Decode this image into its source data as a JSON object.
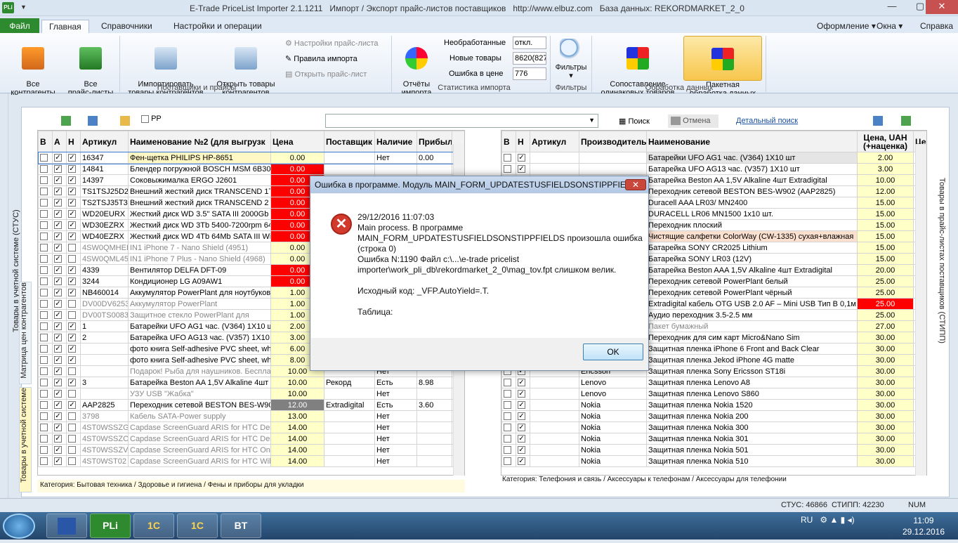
{
  "window": {
    "title": "E-Trade PriceList Importer 2.1.1211   Импорт / Экспорт прайс-листов поставщиков   http://www.elbuz.com   База данных: REKORDMARKET_2_0",
    "app_icon": "PLi"
  },
  "tabs": {
    "file": "Файл",
    "main": "Главная",
    "refs": "Справочники",
    "settings": "Настройки и операции",
    "design": "Оформление",
    "windows": "Окна",
    "help": "Справка"
  },
  "ribbon": {
    "all_contractors": "Все\nконтрагенты",
    "all_pricelists": "Все\nпрайс-листы",
    "imported_goods": "Импортировать\nтовары контрагентов",
    "open_goods": "Открыть товары\nконтрагентов",
    "pricelist_settings": "Настройки прайс-листа",
    "import_rules": "Правила импорта",
    "open_pricelist": "Открыть прайс-лист",
    "reports": "Отчёты\nимпорта",
    "unprocessed_label": "Необработанные",
    "unprocessed_val": "откл.",
    "new_label": "Новые товары",
    "new_val": "8620(827",
    "price_err_label": "Ошибка в цене",
    "price_err_val": "776",
    "filters": "Фильтры",
    "matching": "Сопоставление\nодинаковых товаров",
    "batch": "Пакетная\nобработка данных",
    "g1": "Поставщики и прайсы",
    "g2": "Статистика импорта",
    "g3": "Фильтры",
    "g4": "Обработка данных"
  },
  "toolbar": {
    "pp_label": "PP",
    "search": "Поиск",
    "cancel": "Отмена",
    "adv_search": "Детальный поиск"
  },
  "left_tabs": {
    "t1": "Товары в учетной системе (СТУС)",
    "t2": "Матрица цен контрагентов",
    "t3": "Товары в учетной системе"
  },
  "right_tab": "Товары в прайс-листах поставщиков (СТИПП)",
  "left_table": {
    "headers": [
      "В",
      "А",
      "Н",
      "Артикул",
      "Наименование №2 (для выгрузк",
      "Цена",
      "Поставщик",
      "Наличие",
      "Прибыль"
    ],
    "rows": [
      [
        "16347",
        "Фен-щетка PHILIPS HP-8651",
        "0.00",
        "",
        "Нет",
        "0.00",
        "y",
        "1"
      ],
      [
        "14841",
        "Блендер погружной BOSCH MSM 6B300",
        "0.00",
        "",
        "",
        "",
        "r",
        "1"
      ],
      [
        "14397",
        "Соковыжималка ERGO J2601",
        "0.00",
        "",
        "",
        "",
        "r",
        "1"
      ],
      [
        "TS1TSJ25D2",
        "Внешний жесткий диск TRANSCEND 1TB",
        "0.00",
        "",
        "",
        "",
        "r",
        "1"
      ],
      [
        "TS2TSJ35T3",
        "Внешний жесткий диск TRANSCEND 2 TB",
        "0.00",
        "",
        "",
        "",
        "r",
        "1"
      ],
      [
        "WD20EURX",
        "Жесткий диск WD 3.5\" SATA III 2000Gb",
        "0.00",
        "",
        "",
        "",
        "r",
        "1"
      ],
      [
        "WD30EZRX",
        "Жесткий диск WD 3Tb 5400-7200rpm 64",
        "0.00",
        "",
        "",
        "",
        "r",
        "1"
      ],
      [
        "WD40EZRX",
        "Жесткий диск WD 4Tb 64Mb SATA III Wi",
        "0.00",
        "",
        "",
        "",
        "r",
        "1"
      ],
      [
        "4SW0QMHEE",
        "IN1 iPhone 7 - Nano Shield (4951)",
        "0.00",
        "",
        "",
        "",
        "y",
        "0"
      ],
      [
        "4SW0QML45",
        "IN1 iPhone 7 Plus - Nano Shield (4968)",
        "0.00",
        "",
        "",
        "",
        "y",
        "0"
      ],
      [
        "4339",
        "Вентилятор DELFA DFT-09",
        "0.00",
        "",
        "",
        "",
        "r",
        "1"
      ],
      [
        "3244",
        "Кондиционер LG A09AW1",
        "0.00",
        "",
        "",
        "",
        "r",
        "1"
      ],
      [
        "NB460014",
        "Аккумулятор PowerPlant для ноутбуков",
        "1.00",
        "",
        "",
        "",
        "y",
        "1"
      ],
      [
        "DV00DV6253",
        "Аккумулятор PowerPlant",
        "1.00",
        "",
        "",
        "",
        "y",
        "0"
      ],
      [
        "DV00TS0083",
        "Защитное стекло PowerPlant для",
        "1.00",
        "",
        "",
        "",
        "y",
        "0"
      ],
      [
        "1",
        "Батарейки UFO AG1 час. (V364) 1X10 ш",
        "2.00",
        "",
        "",
        "",
        "y",
        "1"
      ],
      [
        "2",
        "Батарейка UFO AG13 час. (V357) 1X10 ш",
        "3.00",
        "",
        "",
        "",
        "y",
        "1"
      ],
      [
        "",
        "фото книга  Self-adhesive PVC sheet, wh",
        "6.00",
        "",
        "",
        "",
        "y",
        "1"
      ],
      [
        "",
        "фото книга  Self-adhesive PVC sheet, wh",
        "8.00",
        "",
        "",
        "",
        "y",
        "1"
      ],
      [
        "",
        "Подарок! Рыба для наушников. Бесплат",
        "10.00",
        "",
        "Нет",
        "",
        "y",
        "0"
      ],
      [
        "3",
        "Батарейка Beston AA 1,5V Alkaline 4шт E",
        "10.00",
        "Рекорд",
        "Есть",
        "8.98",
        "y",
        "1"
      ],
      [
        "",
        "УЗУ USB \"Жабка\"",
        "10.00",
        "",
        "Нет",
        "",
        "y",
        "0"
      ],
      [
        "AAP2825",
        "Переходник сетевой BESTON BES-W902",
        "12.00",
        "Extradigital",
        "Есть",
        "3.60",
        "g",
        "1"
      ],
      [
        "3798",
        "Кабель SATA-Power supply",
        "13.00",
        "",
        "Нет",
        "",
        "y",
        "0"
      ],
      [
        "4ST0WSSZG",
        "Capdase ScreenGuard ARIS for HTC Desir",
        "14.00",
        "",
        "Нет",
        "",
        "y",
        "0"
      ],
      [
        "4ST0WSSZO",
        "Capdase ScreenGuard ARIS for HTC Desir",
        "14.00",
        "",
        "Нет",
        "",
        "y",
        "0"
      ],
      [
        "4ST0WSSZV",
        "Capdase ScreenGuard ARIS for HTC One",
        "14.00",
        "",
        "Нет",
        "",
        "y",
        "0"
      ],
      [
        "4ST0WST02",
        "Capdase ScreenGuard ARIS for HTC Wildf",
        "14.00",
        "",
        "Нет",
        "",
        "y",
        "0"
      ]
    ],
    "category": "Категория: Бытовая техника / Здоровье и гигиена / Фены и приборы для укладки"
  },
  "right_table": {
    "headers": [
      "В",
      "Н",
      "Артикул",
      "Производитель",
      "Наименование",
      "Цена, UAH (+наценка)",
      "Цена (из"
    ],
    "rows": [
      [
        "",
        "Батарейки UFO AG1 час. (V364) 1X10 шт",
        "2.00",
        "0.9",
        "y"
      ],
      [
        "",
        "Батарейка UFO AG13 час. (V357) 1X10 шт",
        "3.00",
        "0.9",
        "y"
      ],
      [
        "",
        "Батарейка Beston AA 1,5V Alkaline 4шт Extradigital",
        "10.00",
        "5.9",
        "y"
      ],
      [
        "",
        "Переходник сетевой BESTON BES-W902 (AAP2825)",
        "12.00",
        "8.4",
        "y"
      ],
      [
        "",
        "Duracell AAA LR03/ MN2400",
        "15.00",
        "15.",
        "y"
      ],
      [
        "",
        "DURACELL LR06 MN1500 1x10 шт.",
        "15.00",
        "15.",
        "y"
      ],
      [
        "",
        "Переходник плоский",
        "15.00",
        "13.",
        "y"
      ],
      [
        "",
        "Чистящие салфетки ColorWay (CW-1335) сухая+влажная",
        "15.00",
        "5.6",
        "y"
      ],
      [
        "",
        "Батарейка SONY CR2025 Lithium",
        "15.00",
        "6.2",
        "y"
      ],
      [
        "",
        "Батарейка SONY LR03 (12V)",
        "15.00",
        "6.2",
        "y"
      ],
      [
        "",
        "Батарейка Beston AAA 1,5V Alkaline 4шт Extradigital",
        "20.00",
        "11.",
        "y"
      ],
      [
        "",
        "Переходник сетевой PowerPlant белый",
        "25.00",
        "25.",
        "y"
      ],
      [
        "",
        "Переходник сетевой PowerPlant  чёрный",
        "25.00",
        "25.",
        "y"
      ],
      [
        "",
        "Extradigital кабель OTG USB 2.0 AF – Mini USB Тип B 0,1м",
        "25.00",
        "15.",
        "r"
      ],
      [
        "",
        "Аудио переходник 3.5-2.5 мм",
        "25.00",
        "0.2",
        "y"
      ],
      [
        "",
        "Пакет бумажный",
        "27.00",
        "27.",
        "y"
      ],
      [
        "",
        "Переходник для сим карт Micro&Nano Sim",
        "30.00",
        "15.",
        "y"
      ],
      [
        "",
        "Защитная пленка iPhone 6 Front and Back Clear",
        "30.00",
        "15.",
        "y"
      ],
      [
        "",
        "Защитная пленка Jekod iPhone 4G matte",
        "30.00",
        "10.",
        "y"
      ],
      [
        "Ericsson",
        "Защитная пленка Sony Ericsson ST18i",
        "30.00",
        "7.6",
        "y"
      ],
      [
        "Lenovo",
        "Защитная пленка Lenovo A8",
        "30.00",
        "7.6",
        "y"
      ],
      [
        "Lenovo",
        "Защитная пленка Lenovo S860",
        "30.00",
        "7.6",
        "y"
      ],
      [
        "Nokia",
        "Защитная пленка Nokia 1520",
        "30.00",
        "7.6",
        "y"
      ],
      [
        "Nokia",
        "Защитная пленка Nokia 200",
        "30.00",
        "7.6",
        "y"
      ],
      [
        "Nokia",
        "Защитная пленка Nokia 300",
        "30.00",
        "7.6",
        "y"
      ],
      [
        "Nokia",
        "Защитная пленка Nokia 301",
        "30.00",
        "7.6",
        "y"
      ],
      [
        "Nokia",
        "Защитная пленка Nokia 501",
        "30.00",
        "7.6",
        "y"
      ],
      [
        "Nokia",
        "Защитная пленка Nokia 510",
        "30.00",
        "7.6",
        "y"
      ]
    ],
    "category": "Категория: Телефония и связь / Аксессуары к телефонам / Аксессуары для телефонии"
  },
  "dialog": {
    "title": "Ошибка в программе. Модуль MAIN_FORM_UPDATESTUSFIELDSONSTIPPFIELD...",
    "line1": "29/12/2016 11:07:03",
    "line2": "Main process. В программе",
    "line3": "MAIN_FORM_UPDATESTUSFIELDSONSTIPPFIELDS произошла ошибка",
    "line4": "(строка 0)",
    "line5": "Ошибка N:1190 Файл c:\\...\\e-trade pricelist",
    "line6": "importer\\work_pli_db\\rekordmarket_2_0\\mag_tov.fpt слишком велик.",
    "line7": "Исходный код: _VFP.AutoYield=.T.",
    "line8": "Таблица:",
    "ok": "OK"
  },
  "status": {
    "stus": "СТУС: 46866",
    "stipp": "СТИПП: 42230",
    "num": "NUM"
  },
  "taskbar": {
    "lang": "RU",
    "time": "11:09",
    "date": "29.12.2016",
    "app1": "PLi",
    "app2": "1С",
    "app3": "1С",
    "app4": "BT"
  },
  "colors": {
    "file_tab": "#2e8a2e",
    "price_yellow": "#ffffc8",
    "price_red": "#ff0000",
    "dialog_close": "#c9483b"
  }
}
